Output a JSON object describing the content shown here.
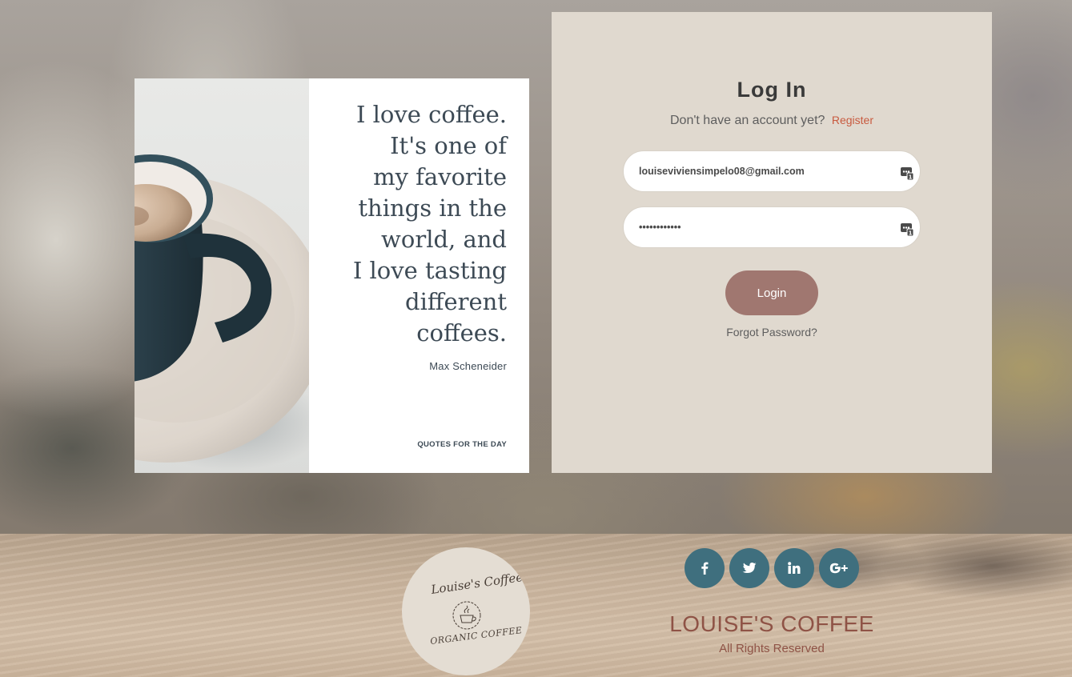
{
  "quote": {
    "text": "I love coffee.\nIt's one of\nmy favorite\nthings in the\nworld, and\nI love tasting\ndifferent\ncoffees.",
    "author": "Max Scheneider",
    "footer": "QUOTES FOR THE DAY"
  },
  "login": {
    "title": "Log In",
    "register_prompt": "Don't have an account yet?",
    "register_link": "Register",
    "email_value": "louiseviviensimpelo08@gmail.com",
    "password_value": "••••••••••••",
    "login_button": "Login",
    "forgot_password": "Forgot Password?"
  },
  "footer": {
    "logo_script": "Louise's Coffee",
    "logo_tagline": "ORGANIC COFFEE",
    "social": [
      {
        "icon": "facebook-icon",
        "glyph": "f"
      },
      {
        "icon": "twitter-icon",
        "glyph": "t"
      },
      {
        "icon": "linkedin-icon",
        "glyph": "in"
      },
      {
        "icon": "google-plus-icon",
        "glyph": "G+"
      }
    ],
    "brand": "LOUISE'S COFFEE",
    "rights": "All Rights Reserved"
  },
  "colors": {
    "panel": "#e0d9cf",
    "accent_button": "#a07770",
    "social": "#3f6f7e",
    "brand_text": "#8f5346",
    "register_link": "#c85a3f"
  }
}
